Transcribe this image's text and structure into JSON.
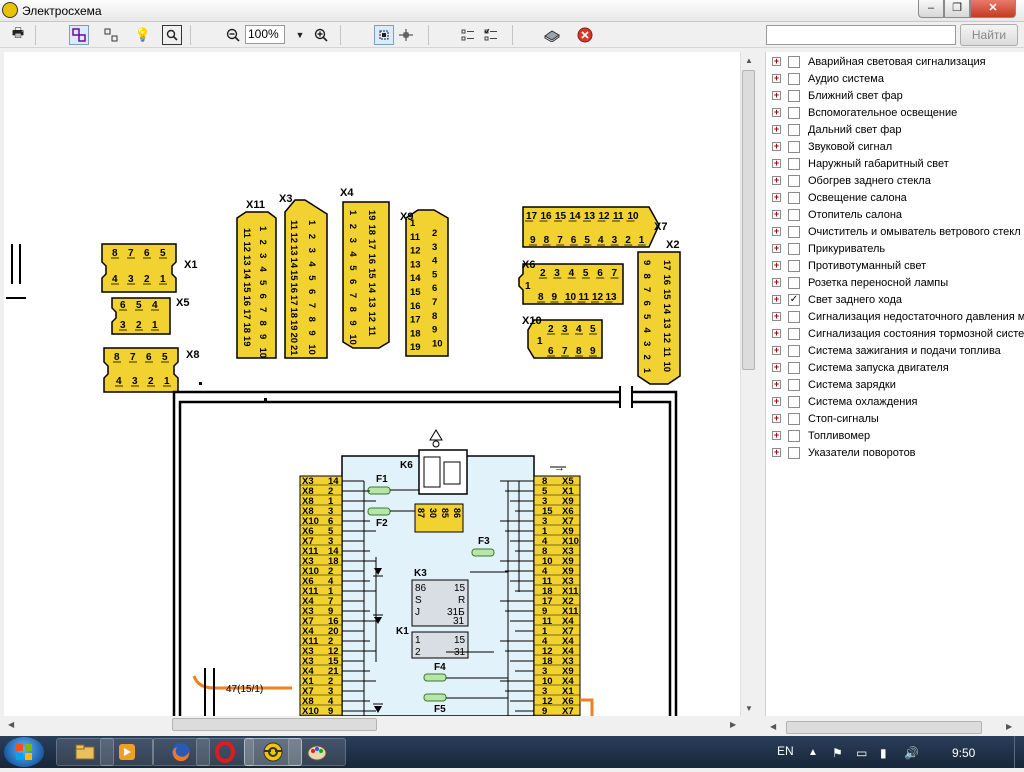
{
  "window": {
    "title": "Электросхема",
    "min": "–",
    "max": "❐",
    "close": "✕"
  },
  "toolbar": {
    "zoom_value": "100%",
    "search_placeholder": "",
    "search_button": "Найти",
    "icons": [
      "print-icon",
      "select-icon",
      "pan-icon",
      "highlight-icon",
      "find-icon",
      "zoom-out-icon",
      "zoom-dropdown-icon",
      "zoom-in-icon",
      "fit-icon",
      "move-icon",
      "list-icon",
      "checklist-icon",
      "book-icon",
      "stop-icon"
    ]
  },
  "tree": {
    "items": [
      {
        "label": "Аварийная световая сигнализация",
        "checked": false
      },
      {
        "label": "Аудио система",
        "checked": false
      },
      {
        "label": "Ближний свет фар",
        "checked": false
      },
      {
        "label": "Вспомогательное освещение",
        "checked": false
      },
      {
        "label": "Дальний свет фар",
        "checked": false
      },
      {
        "label": "Звуковой сигнал",
        "checked": false
      },
      {
        "label": "Наружный габаритный свет",
        "checked": false
      },
      {
        "label": "Обогрев заднего стекла",
        "checked": false
      },
      {
        "label": "Освещение салона",
        "checked": false
      },
      {
        "label": "Отопитель салона",
        "checked": false
      },
      {
        "label": "Очиститель и омыватель ветрового стекл",
        "checked": false
      },
      {
        "label": "Прикуриватель",
        "checked": false
      },
      {
        "label": "Противотуманный свет",
        "checked": false
      },
      {
        "label": "Розетка переносной лампы",
        "checked": false
      },
      {
        "label": "Свет заднего хода",
        "checked": true
      },
      {
        "label": "Сигнализация недостаточного давления м",
        "checked": false
      },
      {
        "label": "Сигнализация состояния тормозной систе",
        "checked": false
      },
      {
        "label": "Система зажигания и подачи топлива",
        "checked": false
      },
      {
        "label": "Система запуска двигателя",
        "checked": false
      },
      {
        "label": "Система зарядки",
        "checked": false
      },
      {
        "label": "Система охлаждения",
        "checked": false
      },
      {
        "label": "Стоп-сигналы",
        "checked": false
      },
      {
        "label": "Топливомер",
        "checked": false
      },
      {
        "label": "Указатели поворотов",
        "checked": false
      }
    ]
  },
  "diagram": {
    "connectors": {
      "X1": {
        "name": "X1",
        "top": [
          "8",
          "7",
          "6",
          "5"
        ],
        "bottom": [
          "4",
          "3",
          "2",
          "1"
        ]
      },
      "X5": {
        "name": "X5",
        "top": [
          "6",
          "5",
          "4"
        ],
        "bottom": [
          "3",
          "2",
          "1"
        ]
      },
      "X8": {
        "name": "X8",
        "top": [
          "8",
          "7",
          "6",
          "5"
        ],
        "bottom": [
          "4",
          "3",
          "2",
          "1"
        ]
      },
      "X11": {
        "name": "X11",
        "col1": [
          "11",
          "12",
          "13",
          "14",
          "15",
          "16",
          "17",
          "18",
          "19"
        ],
        "col2": [
          "1",
          "2",
          "3",
          "4",
          "5",
          "6",
          "7",
          "8",
          "9",
          "10"
        ]
      },
      "X3": {
        "name": "X3",
        "col1": [
          "11",
          "12",
          "13",
          "14",
          "15",
          "16",
          "17",
          "18",
          "19",
          "20",
          "21"
        ],
        "col2": [
          "1",
          "2",
          "3",
          "4",
          "5",
          "6",
          "7",
          "8",
          "9",
          "10"
        ]
      },
      "X4": {
        "name": "X4",
        "col1": [
          "1",
          "2",
          "3",
          "4",
          "5",
          "6",
          "7",
          "8",
          "9",
          "10"
        ],
        "col2": [
          "19",
          "18",
          "17",
          "16",
          "15",
          "14",
          "13",
          "12",
          "11"
        ]
      },
      "X9": {
        "name": "X9",
        "col1": [
          "1",
          "11",
          "12",
          "13",
          "14",
          "15",
          "16",
          "17",
          "18",
          "19"
        ],
        "col2": [
          "2",
          "3",
          "4",
          "5",
          "6",
          "7",
          "8",
          "9",
          "10"
        ]
      },
      "X7": {
        "name": "X7",
        "top": [
          "17",
          "16",
          "15",
          "14",
          "13",
          "12",
          "11",
          "10"
        ],
        "bottom": [
          "9",
          "8",
          "7",
          "6",
          "5",
          "4",
          "3",
          "2",
          "1"
        ]
      },
      "X6": {
        "name": "X6",
        "top": [
          "2",
          "3",
          "4",
          "5",
          "6",
          "7"
        ],
        "bottom": [
          "8",
          "9",
          "10",
          "11",
          "12",
          "13"
        ],
        "left": "1"
      },
      "X10": {
        "name": "X10",
        "top": [
          "2",
          "3",
          "4",
          "5"
        ],
        "bottom": [
          "6",
          "7",
          "8",
          "9"
        ],
        "left": "1"
      },
      "X2": {
        "name": "X2",
        "col1": [
          "17",
          "16",
          "15",
          "14",
          "13",
          "12",
          "11",
          "10"
        ],
        "col2": [
          "9",
          "8",
          "7",
          "6",
          "5",
          "4",
          "3",
          "2",
          "1"
        ]
      }
    },
    "block": {
      "relay_k6": "K6",
      "relay_k6_pins": [
        "87",
        "30",
        "85",
        "86"
      ],
      "relay_k3": "K3",
      "k3_pins": [
        "86",
        "S",
        "J",
        "15",
        "R",
        "31Б",
        "31"
      ],
      "relay_k1": "K1",
      "k1_pins": [
        "1",
        "2",
        "15",
        "31"
      ],
      "fuses": [
        "F1",
        "F2",
        "F3",
        "F4",
        "F5"
      ],
      "wire_label": "47(15/1)",
      "left_pins": [
        {
          "conn": "X3",
          "pin": "14"
        },
        {
          "conn": "X8",
          "pin": "2"
        },
        {
          "conn": "X8",
          "pin": "1"
        },
        {
          "conn": "X8",
          "pin": "3"
        },
        {
          "conn": "X10",
          "pin": "6"
        },
        {
          "conn": "X6",
          "pin": "5"
        },
        {
          "conn": "X7",
          "pin": "3"
        },
        {
          "conn": "X11",
          "pin": "14"
        },
        {
          "conn": "X3",
          "pin": "18"
        },
        {
          "conn": "X10",
          "pin": "2"
        },
        {
          "conn": "X6",
          "pin": "4"
        },
        {
          "conn": "X11",
          "pin": "1"
        },
        {
          "conn": "X4",
          "pin": "7"
        },
        {
          "conn": "X3",
          "pin": "9"
        },
        {
          "conn": "X7",
          "pin": "16"
        },
        {
          "conn": "X4",
          "pin": "20"
        },
        {
          "conn": "X11",
          "pin": "2"
        },
        {
          "conn": "X3",
          "pin": "12"
        },
        {
          "conn": "X3",
          "pin": "15"
        },
        {
          "conn": "X4",
          "pin": "21"
        },
        {
          "conn": "X1",
          "pin": "2"
        },
        {
          "conn": "X7",
          "pin": "3"
        },
        {
          "conn": "X8",
          "pin": "4"
        },
        {
          "conn": "X10",
          "pin": "9"
        }
      ],
      "right_pins": [
        {
          "conn": "X5",
          "pin": "8"
        },
        {
          "conn": "X1",
          "pin": "5"
        },
        {
          "conn": "X9",
          "pin": "3"
        },
        {
          "conn": "X6",
          "pin": "15"
        },
        {
          "conn": "X7",
          "pin": "3"
        },
        {
          "conn": "X9",
          "pin": "1"
        },
        {
          "conn": "X10",
          "pin": "4"
        },
        {
          "conn": "X3",
          "pin": "8"
        },
        {
          "conn": "X9",
          "pin": "10"
        },
        {
          "conn": "X9",
          "pin": "4"
        },
        {
          "conn": "X3",
          "pin": "11"
        },
        {
          "conn": "X11",
          "pin": "18"
        },
        {
          "conn": "X2",
          "pin": "17"
        },
        {
          "conn": "X11",
          "pin": "9"
        },
        {
          "conn": "X4",
          "pin": "11"
        },
        {
          "conn": "X7",
          "pin": "1"
        },
        {
          "conn": "X4",
          "pin": "4"
        },
        {
          "conn": "X4",
          "pin": "12"
        },
        {
          "conn": "X3",
          "pin": "18"
        },
        {
          "conn": "X9",
          "pin": "3"
        },
        {
          "conn": "X4",
          "pin": "10"
        },
        {
          "conn": "X1",
          "pin": "3"
        },
        {
          "conn": "X6",
          "pin": "12"
        },
        {
          "conn": "X7",
          "pin": "9"
        }
      ]
    }
  },
  "taskbar": {
    "lang": "EN",
    "time": "9:50",
    "apps": [
      "explorer-icon",
      "media-player-icon",
      "firefox-icon",
      "opera-icon",
      "electroschema-app-icon",
      "paint-icon"
    ]
  }
}
